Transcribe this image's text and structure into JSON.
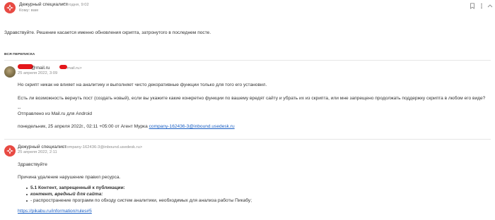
{
  "colors": {
    "brand": "#e84a43",
    "link": "#1a5fc4",
    "redaction": "#e4161a"
  },
  "header": {
    "sender": "Дежурный специалист",
    "time": "Сегодня, 9:02",
    "to": "Кому: вам",
    "icons": [
      "bookmark-icon",
      "more-icon",
      "collapse-icon"
    ]
  },
  "main_message": {
    "text": "Здравствуйте. Решение касается именно обновления скрипта, затронутого в последнем посте."
  },
  "thread_label": "ВСЯ ПЕРЕПИСКА",
  "thread": [
    {
      "sender": "@mail.ru",
      "sender_addr": "mail.ru>",
      "date": "25 апреля 2022, 3:09",
      "p1": "Но скрипт никак не влияет на аналитику и выполняет чисто декоративные функции только для того его установил.",
      "p2": "Есть ли возможность вернуть пост (создать новый), если вы укажите какие конкретно функции по вашему вредят сайту и убрать их из скрипта, или мне запрещено продолжать поддержку скрипта в любом его виде?",
      "sig_dashes": "--",
      "sig": "Отправлено из Mail.ru для Android",
      "quote_prefix": "понедельник, 25 апреля 2022г., 02:11 +05:00 от Агент Мурка",
      "quote_link": "company-162436-3@inbound.usedesk.ru"
    },
    {
      "sender": "Дежурный специалист",
      "sender_addr": "<company-162436-3@inbound.usedesk.ru>",
      "date": "25 апреля 2022, 2:11",
      "greeting": "Здравствуйте",
      "reason": "Причина удаление нарушение правил ресурса.",
      "rule_title": "5.1 Контент, запрещенный к публикации:",
      "rule_sub": "контент, вредный для сайта:",
      "rule_item": "- распространение программ по обходу систем аналитики, необходимых для анализа работы Пикабу;",
      "link": "https://pikabu.ru/information/rules#5"
    }
  ]
}
